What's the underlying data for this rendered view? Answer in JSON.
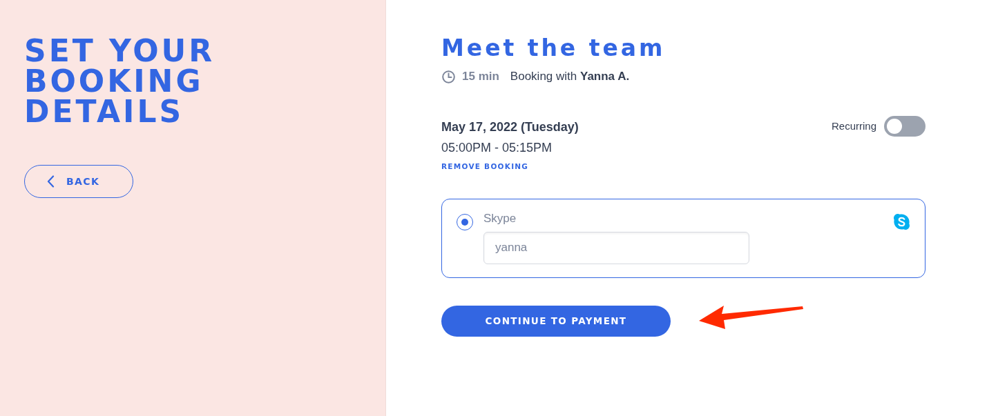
{
  "sidebar": {
    "title": "SET YOUR BOOKING DETAILS",
    "back_button": {
      "label": "BACK"
    }
  },
  "booking": {
    "title": "Meet the team",
    "duration": "15 min",
    "booking_with": "Booking with **Yanna A.**",
    "date": "May 17, 2022 (Tuesday)",
    "time": "05:00PM - 05:15PM",
    "remove_link": "REMOVE BOOKING",
    "recurring": {
      "label": "Recurring",
      "on": false
    }
  },
  "locations": [
    {
      "kind": "skype",
      "label": "Skype",
      "selected": true,
      "value": "yanna"
    }
  ],
  "continue_button": {
    "label": "CONTINUE TO PAYMENT"
  }
}
